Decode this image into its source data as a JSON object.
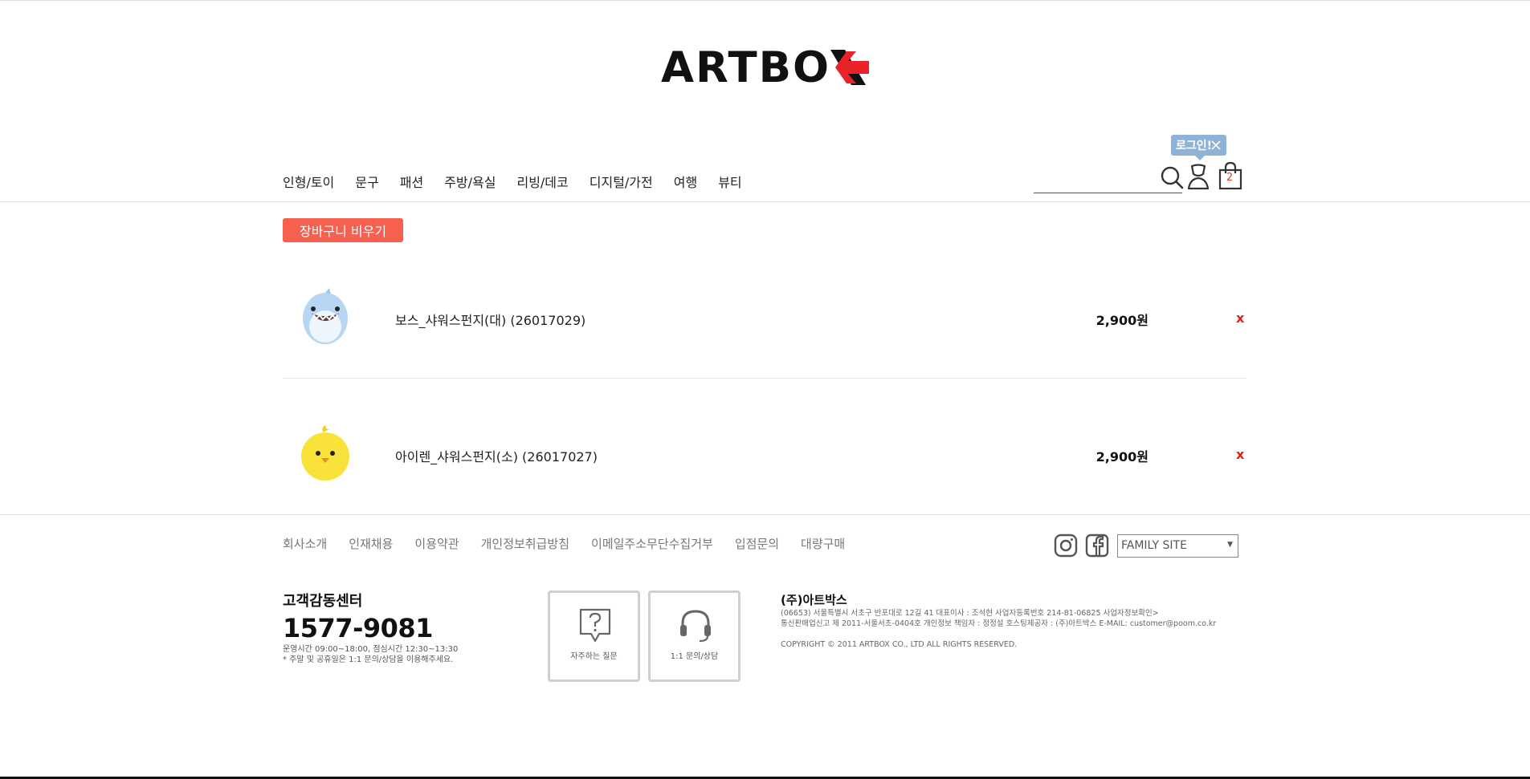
{
  "logo": {
    "text": "ARTBO",
    "icon": "artbox-x-logo-mark",
    "accent": "#e8232a"
  },
  "nav": {
    "items": [
      {
        "label": "인형/토이"
      },
      {
        "label": "문구"
      },
      {
        "label": "패션"
      },
      {
        "label": "주방/욕실"
      },
      {
        "label": "리빙/데코"
      },
      {
        "label": "디지털/가전"
      },
      {
        "label": "여행"
      },
      {
        "label": "뷰티"
      }
    ]
  },
  "header": {
    "search_placeholder": "",
    "login_tip": "로그인!",
    "cart_count": "2",
    "icons": [
      "search-icon",
      "user-icon",
      "shopping-bag-icon",
      "close-icon"
    ]
  },
  "cart": {
    "empty_button": "장바구니 비우기",
    "items": [
      {
        "name": "보스_샤워스펀지(대) (26017029)",
        "price": "2,900원",
        "remove": "x",
        "thumb": "shark-sponge-thumbnail"
      },
      {
        "name": "아이렌_샤워스펀지(소) (26017027)",
        "price": "2,900원",
        "remove": "x",
        "thumb": "chick-sponge-thumbnail"
      }
    ]
  },
  "footer": {
    "links": [
      "회사소개",
      "인재채용",
      "이용약관",
      "개인정보취급방침",
      "이메일주소무단수집거부",
      "입점문의",
      "대량구매"
    ],
    "family_site": "FAMILY SITE",
    "cs_title": "고객감동센터",
    "cs_phone": "1577-9081",
    "cs_hours": "운영시간 09:00~18:00, 점심시간 12:30~13:30",
    "cs_note": "* 주말 및 공휴일은 1:1 문의/상담을 이용해주세요.",
    "faq_label": "자주하는 질문",
    "qna_label": "1:1 문의/상담",
    "company_name": "(주)아트박스",
    "company_line1": "(06653) 서울특별시 서초구 반포대로 12길 41 대표이사 : 조석현 사업자등록번호 214-81-06825 사업자정보확인>",
    "company_line2": "통신판매업신고 제 2011-서울서초-0404호 개인정보 책임자 : 정정설 호스팅제공자 : (주)아트박스 E-MAIL: customer@poom.co.kr",
    "copyright": "COPYRIGHT © 2011 ARTBOX CO., LTD ALL RIGHTS RESERVED."
  },
  "colors": {
    "accent": "#f5614e",
    "tooltip": "#8fb3d6",
    "remove": "#e0201a"
  }
}
